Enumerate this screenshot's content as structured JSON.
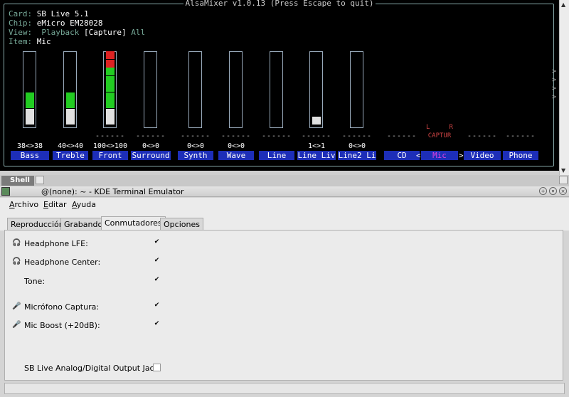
{
  "mixer": {
    "title": "AlsaMixer v1.0.13 (Press Escape to quit)",
    "card_label": "Card:",
    "card_value": "SB Live 5.1",
    "chip_label": "Chip:",
    "chip_value": "eMicro EM28028",
    "view_label": "View:",
    "view_playback": "Playback",
    "view_capture": "[Capture]",
    "view_all": "All",
    "item_label": "Item:",
    "item_value": "Mic",
    "channels": [
      {
        "name": "Bass",
        "value": "38<>38",
        "level": 0.45
      },
      {
        "name": "Treble",
        "value": "40<>40",
        "level": 0.45
      },
      {
        "name": "Front",
        "value": "100<>100",
        "dash": "------",
        "level": 1.0
      },
      {
        "name": "Surround",
        "value": "0<>0",
        "dash": "------",
        "level": 0
      },
      {
        "name": "Synth",
        "value": "0<>0",
        "dash": "------",
        "level": 0
      },
      {
        "name": "Wave",
        "value": "0<>0",
        "dash": "------",
        "level": 0
      },
      {
        "name": "Line",
        "dash": "------",
        "level": 0
      },
      {
        "name": "Line Liv",
        "value": "1<>1",
        "dash": "------",
        "level": 0.1
      },
      {
        "name": "Line2 Li",
        "value": "0<>0",
        "dash": "------",
        "level": 0
      },
      {
        "name": "CD",
        "dash": "------"
      },
      {
        "name": "Mic",
        "cap_lr": "L     R",
        "capture": "CAPTUR",
        "selected": true,
        "arrow_left": "<",
        "arrow_right": ">"
      },
      {
        "name": "Video",
        "dash": "------"
      },
      {
        "name": "Phone",
        "dash": "------"
      }
    ],
    "scroll_arrows": [
      ">",
      ">",
      ">",
      ">"
    ]
  },
  "shell_tab": "Shell",
  "window": {
    "title": "@(none): ~ - KDE Terminal Emulator"
  },
  "menu": {
    "archivo": "Archivo",
    "editar": "Editar",
    "ayuda": "Ayuda"
  },
  "tabs": [
    "Reproducción",
    "Grabando",
    "Conmutadores",
    "Opciones"
  ],
  "active_tab": "Conmutadores",
  "switches": [
    {
      "label": "Headphone LFE:",
      "checked": true,
      "icon": "headphones-icon"
    },
    {
      "label": "Headphone Center:",
      "checked": true,
      "icon": "headphones-icon"
    },
    {
      "label": "Tone:",
      "checked": true
    },
    {
      "label": "Micrófono Captura:",
      "checked": true,
      "icon": "microphone-icon"
    },
    {
      "label": "Mic Boost (+20dB):",
      "checked": true,
      "icon": "microphone-icon"
    },
    {
      "label": "SB Live Analog/Digital Output Jack:",
      "checked": false
    }
  ],
  "colors": {
    "mixer_bg": "#000000",
    "name_bg": "#1d2eb8",
    "green": "#22cc22",
    "red": "#dd2222",
    "white_seg": "#e0e0e0"
  }
}
